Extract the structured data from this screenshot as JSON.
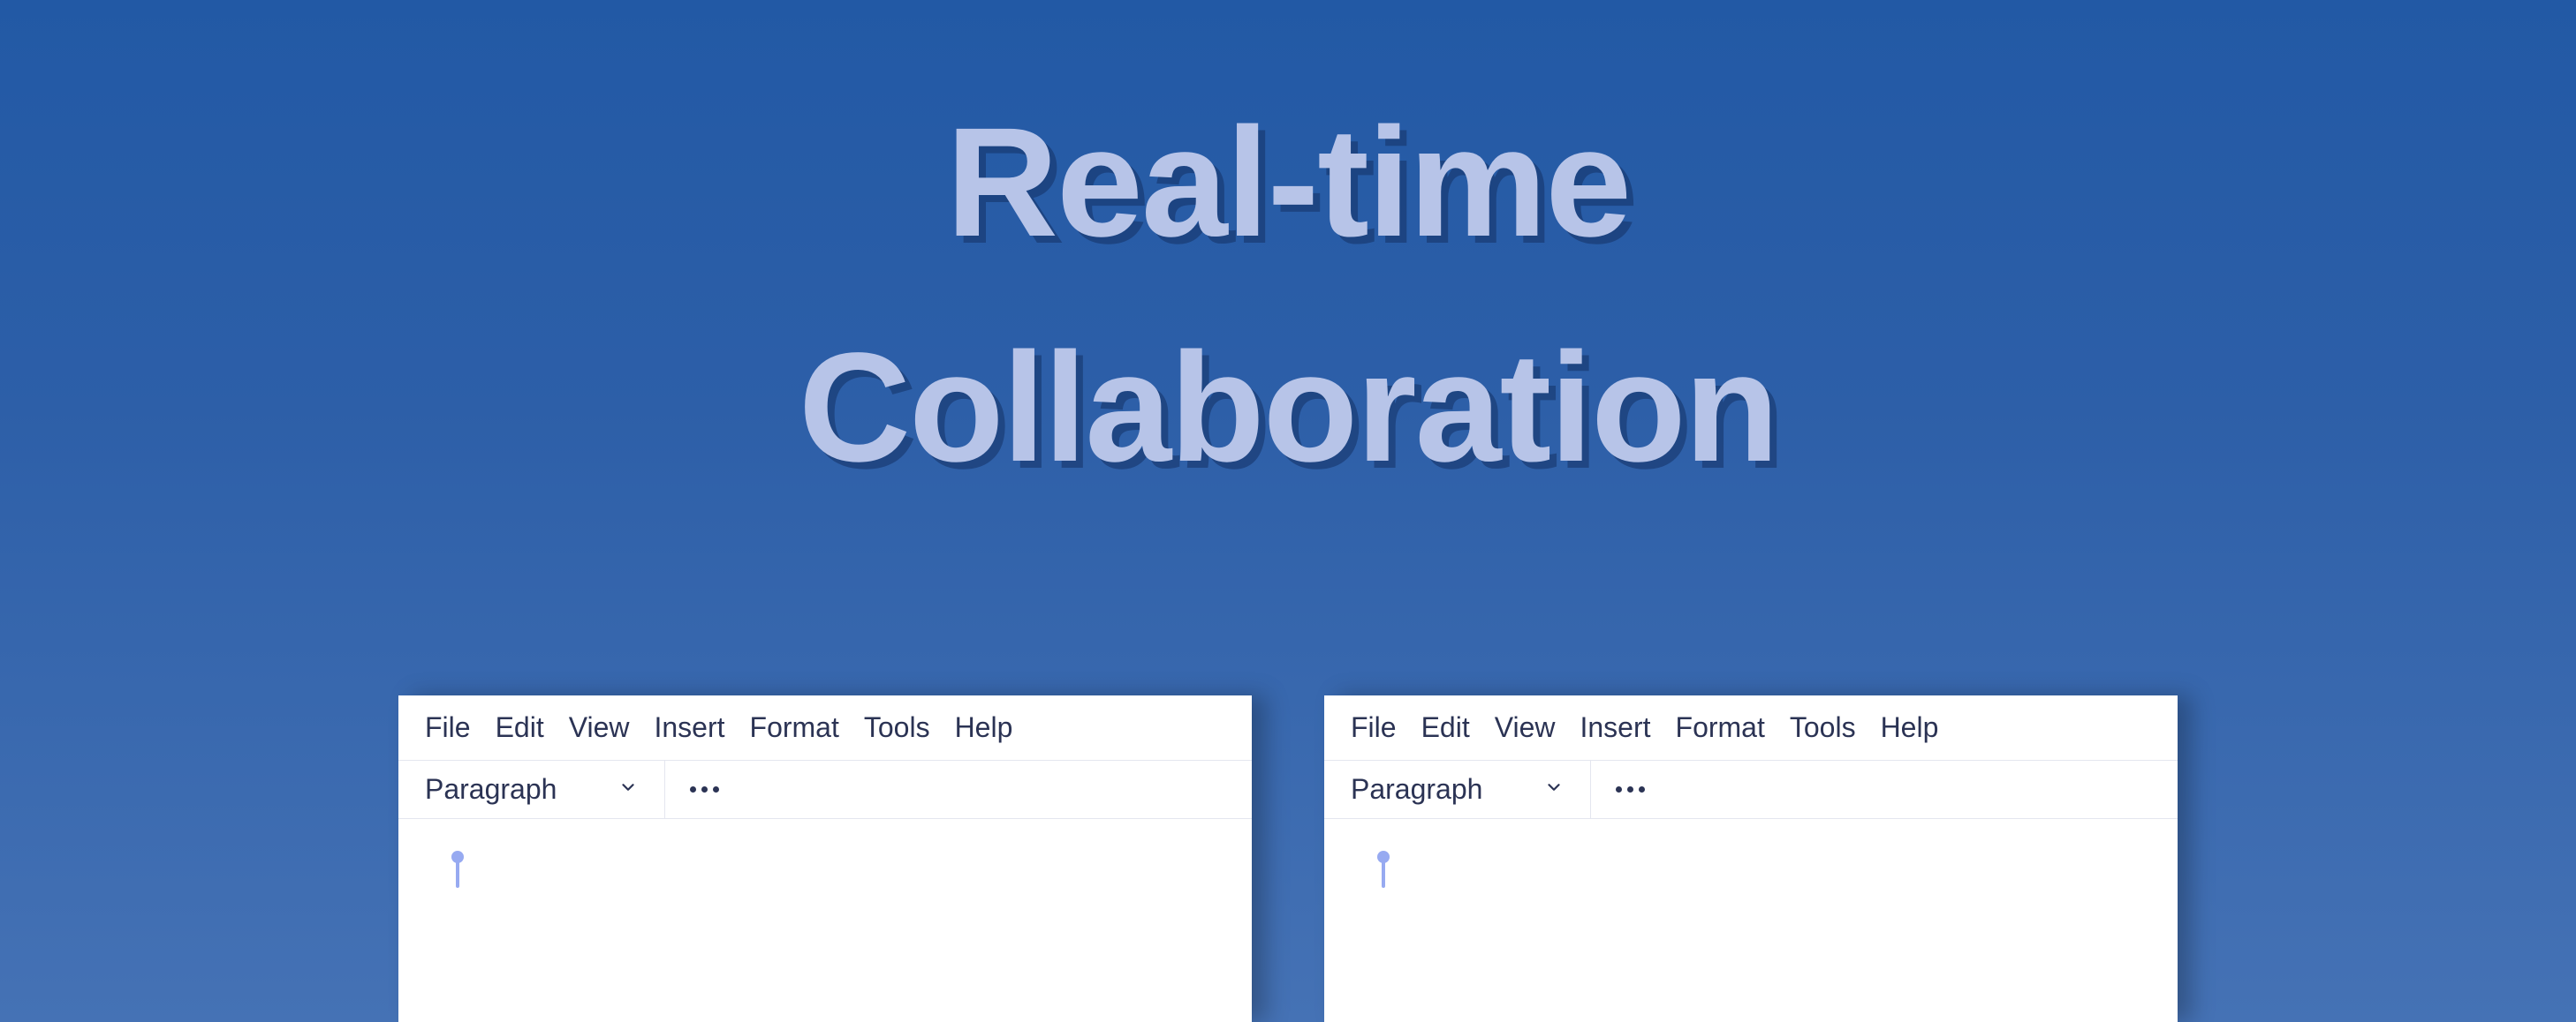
{
  "hero": {
    "line1": "Real-time",
    "line2": "Collaboration"
  },
  "editor": {
    "menu": {
      "file": "File",
      "edit": "Edit",
      "view": "View",
      "insert": "Insert",
      "format": "Format",
      "tools": "Tools",
      "help": "Help"
    },
    "toolbar": {
      "block_type": "Paragraph"
    }
  }
}
